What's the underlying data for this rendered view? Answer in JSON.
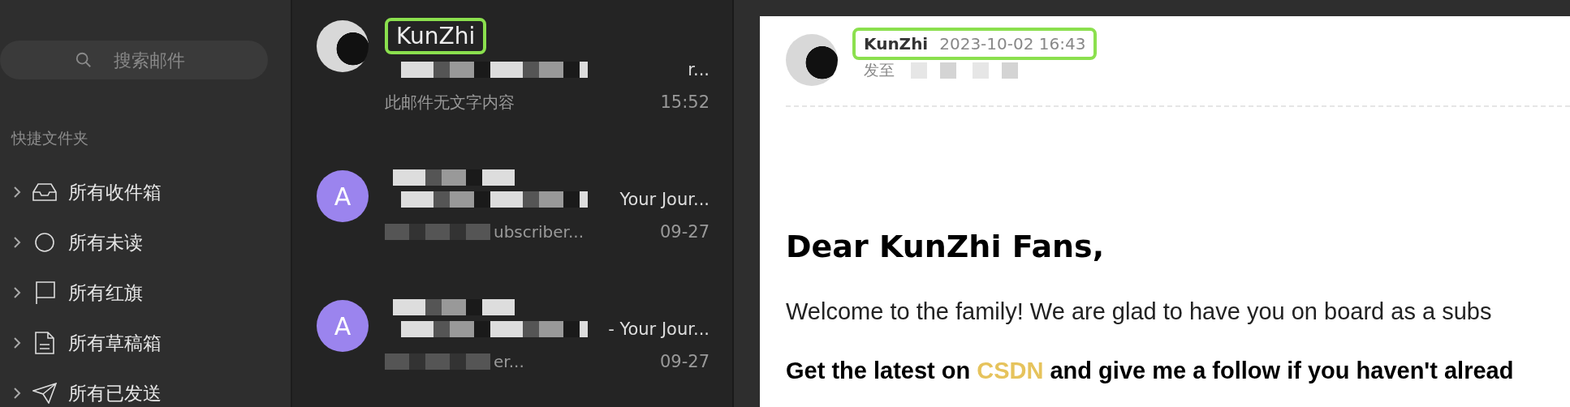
{
  "sidebar": {
    "search": {
      "placeholder": "搜索邮件"
    },
    "section_title": "快捷文件夹",
    "folders": [
      {
        "kind": "inbox",
        "label": "所有收件箱"
      },
      {
        "kind": "unread",
        "label": "所有未读"
      },
      {
        "kind": "flag",
        "label": "所有红旗"
      },
      {
        "kind": "draft",
        "label": "所有草稿箱"
      },
      {
        "kind": "sent",
        "label": "所有已发送"
      }
    ]
  },
  "mail_list": [
    {
      "kind": "photo",
      "sender": "KunZhi",
      "highlighted": true,
      "subject": "r...",
      "preview": "此邮件无文字内容",
      "time": "15:52"
    },
    {
      "kind": "letter",
      "initial": "A",
      "subject": "Your Jour...",
      "preview": "ubscriber...",
      "time": "09-27"
    },
    {
      "kind": "letter",
      "initial": "A",
      "subject": "- Your Jour...",
      "preview": "er...",
      "time": "09-27"
    }
  ],
  "message": {
    "sender": "KunZhi",
    "date": "2023-10-02 16:43",
    "highlighted": true,
    "to_label": "发至",
    "heading": "Dear KunZhi Fans,",
    "paragraphs": [
      {
        "kind": "normal",
        "text": "Welcome to the family! We are glad to have you on board as a subs"
      },
      {
        "kind": "bold",
        "before": "Get the latest on ",
        "link": "CSDN",
        "after": " and give me a follow if you haven't alread"
      }
    ]
  }
}
